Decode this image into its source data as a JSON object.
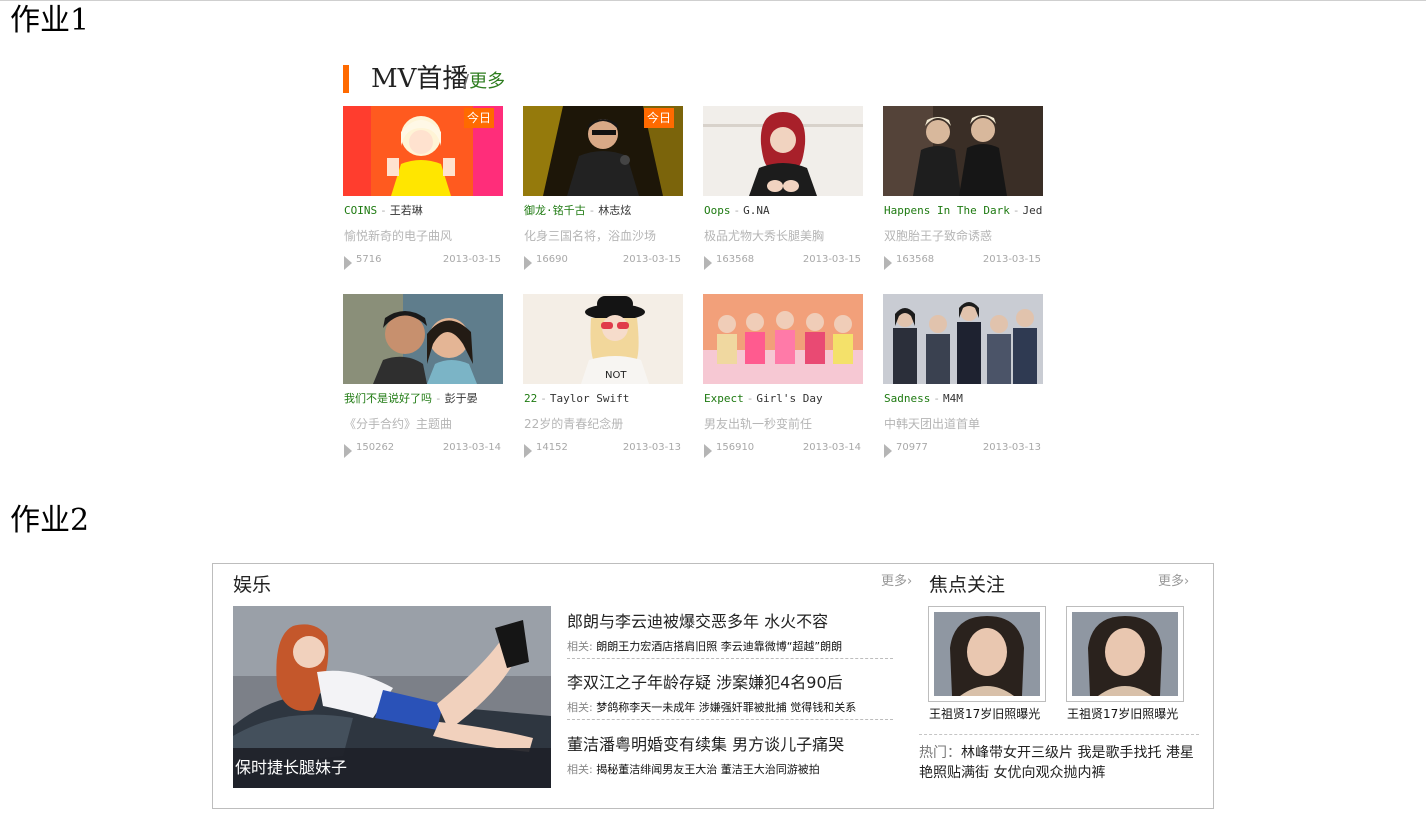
{
  "hw1_title": "作业1",
  "hw2_title": "作业2",
  "mv": {
    "title": "MV首播",
    "slash": "/",
    "more": "更多",
    "accent": "#ff6a00",
    "cards": [
      {
        "song": "COINS",
        "artist": "王若琳",
        "desc": "愉悦新奇的电子曲风",
        "count": "5716",
        "date": "2013-03-15",
        "badge": "今日"
      },
      {
        "song": "御龙·铭千古",
        "artist": "林志炫",
        "desc": "化身三国名将，浴血沙场",
        "count": "16690",
        "date": "2013-03-15",
        "badge": "今日"
      },
      {
        "song": "Oops",
        "artist": "G.NA",
        "desc": "极品尤物大秀长腿美胸",
        "count": "163568",
        "date": "2013-03-15",
        "badge": ""
      },
      {
        "song": "Happens In The Dark",
        "artist": "Jed",
        "desc": "双胞胎王子致命诱惑",
        "count": "163568",
        "date": "2013-03-15",
        "badge": ""
      },
      {
        "song": "我们不是说好了吗",
        "artist": "彭于晏",
        "desc": "《分手合约》主题曲",
        "count": "150262",
        "date": "2013-03-14",
        "badge": ""
      },
      {
        "song": "22",
        "artist": "Taylor Swift",
        "desc": "22岁的青春纪念册",
        "count": "14152",
        "date": "2013-03-13",
        "badge": ""
      },
      {
        "song": "Expect",
        "artist": "Girl's Day",
        "desc": "男友出轨一秒变前任",
        "count": "156910",
        "date": "2013-03-14",
        "badge": ""
      },
      {
        "song": "Sadness",
        "artist": "M4M",
        "desc": "中韩天团出道首单",
        "count": "70977",
        "date": "2013-03-13",
        "badge": ""
      }
    ]
  },
  "ent": {
    "title": "娱乐",
    "more": "更多›",
    "main_caption": "保时捷长腿妹子",
    "news": [
      {
        "headline": "郎朗与李云迪被爆交恶多年 水火不容",
        "rel_label": "相关:",
        "rel_text": "朗朗王力宏酒店搭肩旧照 李云迪靠微博“超越”朗朗"
      },
      {
        "headline": "李双江之子年龄存疑 涉案嫌犯4名90后",
        "rel_label": "相关:",
        "rel_text": "梦鸽称李天一未成年 涉嫌强奸罪被批捕 觉得钱和关系"
      },
      {
        "headline": "董洁潘粤明婚变有续集 男方谈儿子痛哭",
        "rel_label": "相关:",
        "rel_text": "揭秘董洁绯闻男友王大治 董洁王大治同游被拍"
      }
    ],
    "focus_title": "焦点关注",
    "focus_more": "更多›",
    "focus_items": [
      {
        "caption": "王祖贤17岁旧照曝光"
      },
      {
        "caption": "王祖贤17岁旧照曝光"
      }
    ],
    "hot_label": "热门：",
    "hot_text": "林峰带女开三级片 我是歌手找托 港星艳照贴满街 女优向观众抛内裤"
  }
}
